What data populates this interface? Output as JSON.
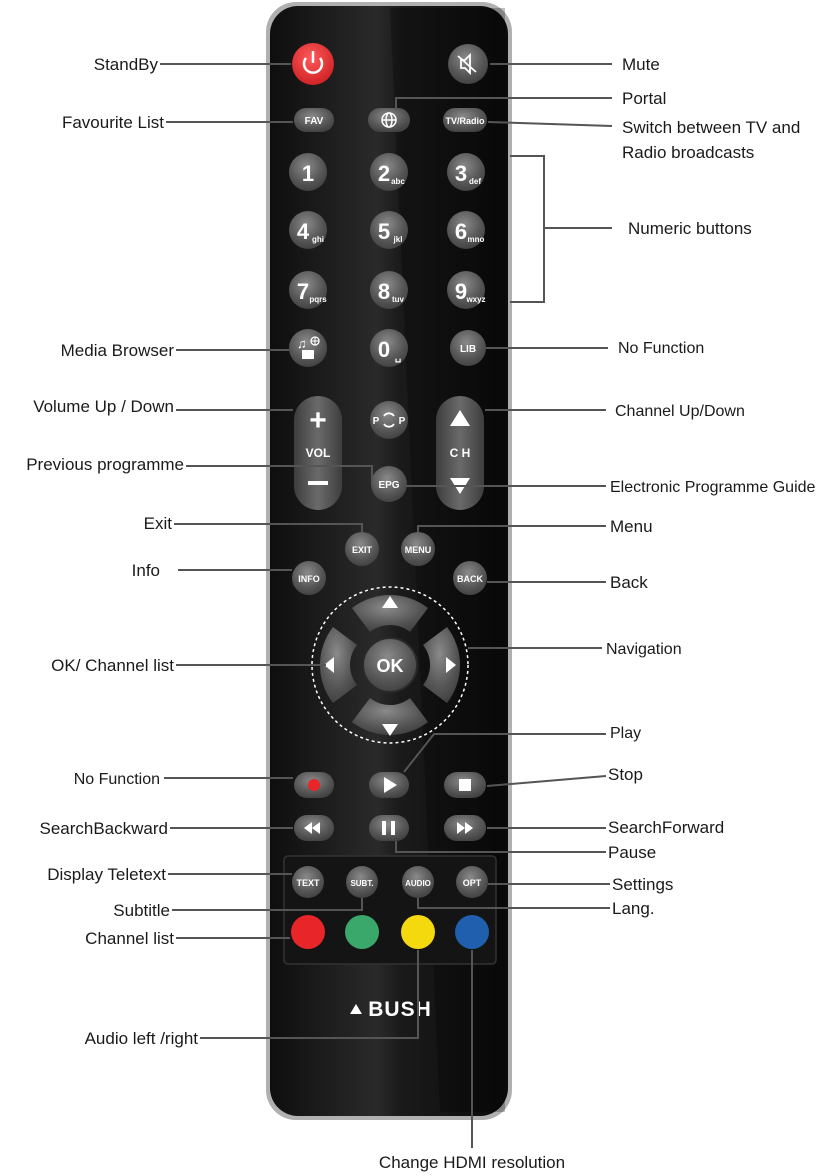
{
  "brand": "BUSH",
  "colors": {
    "body": "#1c1c1c",
    "button": "#5a5a5a",
    "standby": "#e8262a",
    "record": "#e8262a",
    "red": "#e8262a",
    "green": "#3aa86a",
    "yellow": "#f5d90f",
    "blue": "#1f5fae"
  },
  "buttons": {
    "standby_icon": "power-icon",
    "mute_icon": "mute-icon",
    "fav": "FAV",
    "portal_icon": "globe-icon",
    "tvradio": "TV/Radio",
    "n1": "1",
    "n2": "2",
    "n2s": "abc",
    "n3": "3",
    "n3s": "def",
    "n4": "4",
    "n4s": "ghi",
    "n5": "5",
    "n5s": "jkl",
    "n6": "6",
    "n6s": "mno",
    "n7": "7",
    "n7s": "pqrs",
    "n8": "8",
    "n8s": "tuv",
    "n9": "9",
    "n9s": "wxyz",
    "n0": "0",
    "n0s": "␣",
    "media_icon": "media-browser-icon",
    "lib": "LIB",
    "vol": "VOL",
    "ch": "C H",
    "p_left": "P",
    "p_right": "P",
    "epg": "EPG",
    "exit": "EXIT",
    "menu": "MENU",
    "info": "INFO",
    "back": "BACK",
    "ok": "OK",
    "text": "TEXT",
    "subt": "SUBT.",
    "audio": "AUDIO",
    "opt": "OPT"
  },
  "labels": {
    "standby": "StandBy",
    "mute": "Mute",
    "portal": "Portal",
    "favourite": "Favourite List",
    "tvradio_1": "Switch between TV and",
    "tvradio_2": "Radio broadcasts",
    "numeric": "Numeric buttons",
    "media": "Media Browser",
    "lib": "No Function",
    "volume": "Volume Up / Down",
    "channel": "Channel Up/Down",
    "previous": "Previous programme",
    "epg": "Electronic Programme Guide",
    "exit": "Exit",
    "menu": "Menu",
    "info": "Info",
    "back": "Back",
    "navigation": "Navigation",
    "ok": "OK/ Channel list",
    "play": "Play",
    "record": "No Function",
    "stop": "Stop",
    "search_back": "SearchBackward",
    "search_fwd": "SearchForward",
    "pause": "Pause",
    "teletext": "Display Teletext",
    "settings": "Settings",
    "subtitle": "Subtitle",
    "lang": "Lang.",
    "channel_list": "Channel list",
    "audio_lr": "Audio left /right",
    "hdmi": "Change HDMI resolution"
  }
}
